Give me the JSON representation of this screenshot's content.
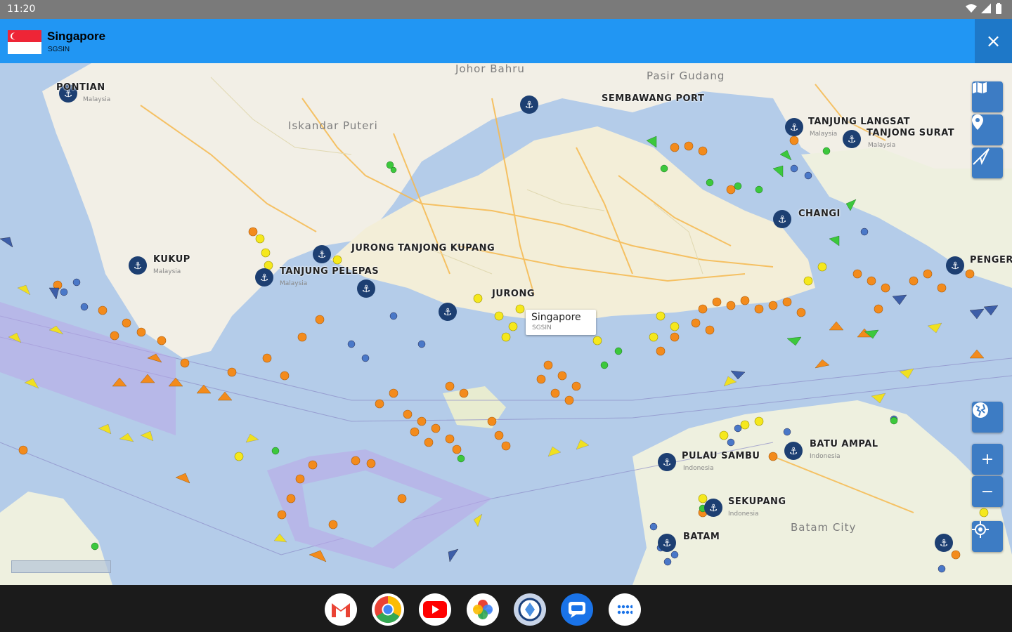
{
  "status_bar": {
    "time": "11:20"
  },
  "header": {
    "port_name": "Singapore",
    "port_code": "SGSIN",
    "close_label": "×"
  },
  "map": {
    "area_labels": [
      "Johor Bahru",
      "Pasir Gudang",
      "Iskandar Puteri",
      "Batam City"
    ],
    "port_labels": [
      "PONTIAN",
      "SEMBAWANG PORT",
      "TANJUNG LANGSAT",
      "TANJONG SURAT",
      "CHANGI",
      "PENGERANG",
      "KUKUP",
      "TANJUNG PELEPAS",
      "JURONG TANJONG KUPANG",
      "JURONG",
      "BATU AMPAL",
      "PULAU SAMBU",
      "SEKUPANG",
      "BATAM"
    ],
    "country_labels": [
      "Malaysia",
      "Indonesia"
    ],
    "callout": {
      "title": "Singapore",
      "code": "SGSIN"
    }
  },
  "map_controls": [
    "map-layers-icon",
    "location-pin-icon",
    "route-icon",
    "globe-icon",
    "zoom-in-icon",
    "zoom-out-icon",
    "my-location-icon"
  ],
  "zoom_in_label": "+",
  "zoom_out_label": "−",
  "dock": [
    "gmail-icon",
    "chrome-icon",
    "youtube-icon",
    "photos-icon",
    "app-icon",
    "messages-icon",
    "apps-grid-icon"
  ]
}
